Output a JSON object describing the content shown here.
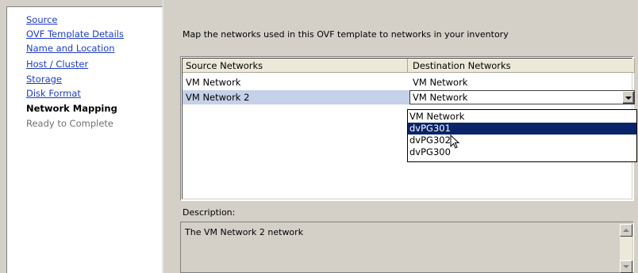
{
  "nav": {
    "items": [
      {
        "label": "Source",
        "state": "link"
      },
      {
        "label": "OVF Template Details",
        "state": "link"
      },
      {
        "label": "Name and Location",
        "state": "link"
      },
      {
        "label": "Host / Cluster",
        "state": "link"
      },
      {
        "label": "Storage",
        "state": "link"
      },
      {
        "label": "Disk Format",
        "state": "link"
      },
      {
        "label": "Network Mapping",
        "state": "current"
      },
      {
        "label": "Ready to Complete",
        "state": "disabled"
      }
    ]
  },
  "main": {
    "instruction": "Map the networks used in this OVF template to networks in your inventory",
    "table": {
      "columns": [
        "Source Networks",
        "Destination Networks"
      ],
      "rows": [
        {
          "source": "VM Network",
          "destination": "VM Network"
        },
        {
          "source": "VM Network 2",
          "destination": "VM Network"
        }
      ]
    },
    "dropdown": {
      "options": [
        "VM Network",
        "dvPG301",
        "dvPG302",
        "dvPG300"
      ],
      "highlighted": "dvPG301"
    },
    "description": {
      "label": "Description:",
      "text": "The VM Network 2 network"
    }
  },
  "colors": {
    "link": "#1e3cc8",
    "selection": "#0a246a",
    "row_highlight": "#c5d1e8"
  }
}
